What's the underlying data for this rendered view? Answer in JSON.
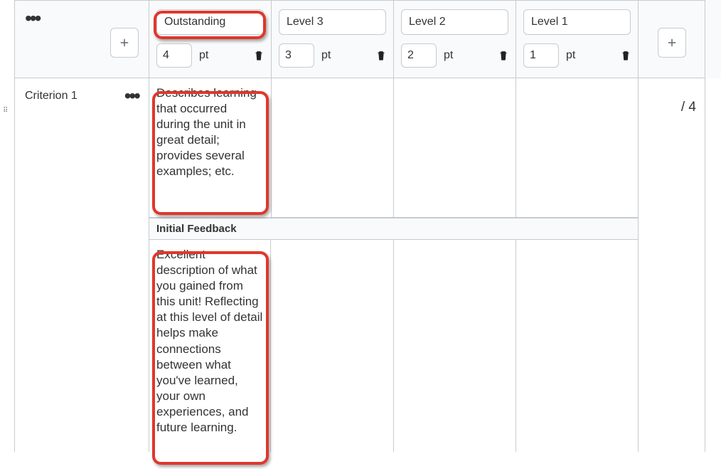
{
  "header": {
    "levels": [
      {
        "name": "Outstanding",
        "points": "4"
      },
      {
        "name": "Level 3",
        "points": "3"
      },
      {
        "name": "Level 2",
        "points": "2"
      },
      {
        "name": "Level 1",
        "points": "1"
      }
    ],
    "pt_label": "pt"
  },
  "criterion": {
    "label": "Criterion 1",
    "max_points_display": "/ 4",
    "descriptions": [
      "Describes learning that occurred during the unit in great detail; provides several examples; etc.",
      "",
      "",
      ""
    ],
    "feedback_header": "Initial Feedback",
    "feedback": [
      "Excellent description of what you gained from this unit! Reflecting at this level of detail helps make connections between what you've learned, your own experiences, and future learning.",
      "",
      "",
      ""
    ]
  }
}
